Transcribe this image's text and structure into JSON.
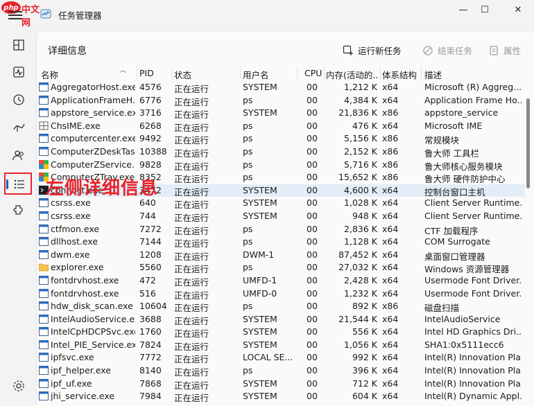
{
  "brand": {
    "badge": "php",
    "name": "中文网"
  },
  "window": {
    "title": "任务管理器",
    "minimize": "—",
    "maximize": "☐",
    "close": "✕"
  },
  "nav": {
    "items": [
      "processes",
      "performance",
      "app-history",
      "startup",
      "users",
      "details",
      "services"
    ],
    "selected": "details",
    "settings": "settings"
  },
  "page": {
    "title": "详细信息"
  },
  "toolbar": {
    "run_new_task": "运行新任务",
    "end_task": "结束任务",
    "properties": "属性"
  },
  "annotation": "左侧详细信息",
  "columns": {
    "name": "名称",
    "pid": "PID",
    "status": "状态",
    "user": "用户名",
    "cpu": "CPU",
    "memory": "内存(活动的...",
    "arch": "体系结构",
    "desc": "描述"
  },
  "rows": [
    {
      "icon": "window",
      "name": "AggregatorHost.exe",
      "pid": "4576",
      "status": "正在运行",
      "user": "SYSTEM",
      "cpu": "00",
      "mem": "1,212 K",
      "arch": "x64",
      "desc": "Microsoft (R) Aggreg..."
    },
    {
      "icon": "window",
      "name": "ApplicationFrameH...",
      "pid": "6776",
      "status": "正在运行",
      "user": "ps",
      "cpu": "00",
      "mem": "4,384 K",
      "arch": "x64",
      "desc": "Application Frame Ho..."
    },
    {
      "icon": "window",
      "name": "appstore_service.exe",
      "pid": "3716",
      "status": "正在运行",
      "user": "SYSTEM",
      "cpu": "00",
      "mem": "21,836 K",
      "arch": "x86",
      "desc": "appstore_service"
    },
    {
      "icon": "ime",
      "name": "ChsIME.exe",
      "pid": "6268",
      "status": "正在运行",
      "user": "ps",
      "cpu": "00",
      "mem": "476 K",
      "arch": "x64",
      "desc": "Microsoft IME"
    },
    {
      "icon": "window",
      "name": "computercenter.exe",
      "pid": "9492",
      "status": "正在运行",
      "user": "ps",
      "cpu": "00",
      "mem": "5,156 K",
      "arch": "x86",
      "desc": "常规模块"
    },
    {
      "icon": "window",
      "name": "ComputerZDeskTas...",
      "pid": "10388",
      "status": "正在运行",
      "user": "ps",
      "cpu": "00",
      "mem": "2,152 K",
      "arch": "x86",
      "desc": "鲁大师 工具栏"
    },
    {
      "icon": "colorful",
      "name": "ComputerZService....",
      "pid": "9828",
      "status": "正在运行",
      "user": "ps",
      "cpu": "00",
      "mem": "5,716 K",
      "arch": "x86",
      "desc": "鲁大师核心服务模块"
    },
    {
      "icon": "colorful",
      "name": "ComputerZTray.exe",
      "pid": "8352",
      "status": "正在运行",
      "user": "ps",
      "cpu": "00",
      "mem": "15,652 K",
      "arch": "x86",
      "desc": "鲁大师 硬件防护中心"
    },
    {
      "icon": "console",
      "name": "conhost.exe",
      "pid": "3472",
      "status": "正在运行",
      "user": "SYSTEM",
      "cpu": "00",
      "mem": "4,600 K",
      "arch": "x64",
      "desc": "控制台窗口主机",
      "selected": true
    },
    {
      "icon": "window",
      "name": "csrss.exe",
      "pid": "640",
      "status": "正在运行",
      "user": "SYSTEM",
      "cpu": "00",
      "mem": "1,028 K",
      "arch": "x64",
      "desc": "Client Server Runtime..."
    },
    {
      "icon": "window",
      "name": "csrss.exe",
      "pid": "744",
      "status": "正在运行",
      "user": "SYSTEM",
      "cpu": "00",
      "mem": "948 K",
      "arch": "x64",
      "desc": "Client Server Runtime..."
    },
    {
      "icon": "window",
      "name": "ctfmon.exe",
      "pid": "7272",
      "status": "正在运行",
      "user": "ps",
      "cpu": "00",
      "mem": "2,836 K",
      "arch": "x64",
      "desc": "CTF 加载程序"
    },
    {
      "icon": "window",
      "name": "dllhost.exe",
      "pid": "7144",
      "status": "正在运行",
      "user": "ps",
      "cpu": "00",
      "mem": "1,128 K",
      "arch": "x64",
      "desc": "COM Surrogate"
    },
    {
      "icon": "window",
      "name": "dwm.exe",
      "pid": "1208",
      "status": "正在运行",
      "user": "DWM-1",
      "cpu": "00",
      "mem": "87,452 K",
      "arch": "x64",
      "desc": "桌面窗口管理器"
    },
    {
      "icon": "folder",
      "name": "explorer.exe",
      "pid": "5560",
      "status": "正在运行",
      "user": "ps",
      "cpu": "00",
      "mem": "27,032 K",
      "arch": "x64",
      "desc": "Windows 资源管理器"
    },
    {
      "icon": "window",
      "name": "fontdrvhost.exe",
      "pid": "472",
      "status": "正在运行",
      "user": "UMFD-1",
      "cpu": "00",
      "mem": "2,428 K",
      "arch": "x64",
      "desc": "Usermode Font Driver..."
    },
    {
      "icon": "window",
      "name": "fontdrvhost.exe",
      "pid": "516",
      "status": "正在运行",
      "user": "UMFD-0",
      "cpu": "00",
      "mem": "1,232 K",
      "arch": "x64",
      "desc": "Usermode Font Driver..."
    },
    {
      "icon": "window",
      "name": "hdw_disk_scan.exe",
      "pid": "10604",
      "status": "正在运行",
      "user": "ps",
      "cpu": "00",
      "mem": "892 K",
      "arch": "x86",
      "desc": "磁盘扫描"
    },
    {
      "icon": "window",
      "name": "IntelAudioService.exe",
      "pid": "3688",
      "status": "正在运行",
      "user": "SYSTEM",
      "cpu": "00",
      "mem": "21,544 K",
      "arch": "x64",
      "desc": "IntelAudioService"
    },
    {
      "icon": "window",
      "name": "IntelCpHDCPSvc.exe",
      "pid": "1760",
      "status": "正在运行",
      "user": "SYSTEM",
      "cpu": "00",
      "mem": "556 K",
      "arch": "x64",
      "desc": "Intel HD Graphics Dri..."
    },
    {
      "icon": "window",
      "name": "Intel_PIE_Service.exe",
      "pid": "7824",
      "status": "正在运行",
      "user": "SYSTEM",
      "cpu": "00",
      "mem": "1,056 K",
      "arch": "x64",
      "desc": "SHA1:0x5111ecc6"
    },
    {
      "icon": "window",
      "name": "ipfsvc.exe",
      "pid": "7772",
      "status": "正在运行",
      "user": "LOCAL SE...",
      "cpu": "00",
      "mem": "992 K",
      "arch": "x64",
      "desc": "Intel(R) Innovation Pla..."
    },
    {
      "icon": "window",
      "name": "ipf_helper.exe",
      "pid": "8140",
      "status": "正在运行",
      "user": "ps",
      "cpu": "00",
      "mem": "396 K",
      "arch": "x64",
      "desc": "Intel(R) Innovation Pla..."
    },
    {
      "icon": "window",
      "name": "ipf_uf.exe",
      "pid": "7868",
      "status": "正在运行",
      "user": "SYSTEM",
      "cpu": "00",
      "mem": "712 K",
      "arch": "x64",
      "desc": "Intel(R) Innovation Pla..."
    },
    {
      "icon": "window",
      "name": "jhi_service.exe",
      "pid": "7984",
      "status": "正在运行",
      "user": "SYSTEM",
      "cpu": "00",
      "mem": "604 K",
      "arch": "x64",
      "desc": "Intel(R) Dynamic Appl..."
    }
  ],
  "colors": {
    "accent": "#0067c0",
    "annotation": "#e8242b",
    "selected_row": "#e3edf7"
  }
}
